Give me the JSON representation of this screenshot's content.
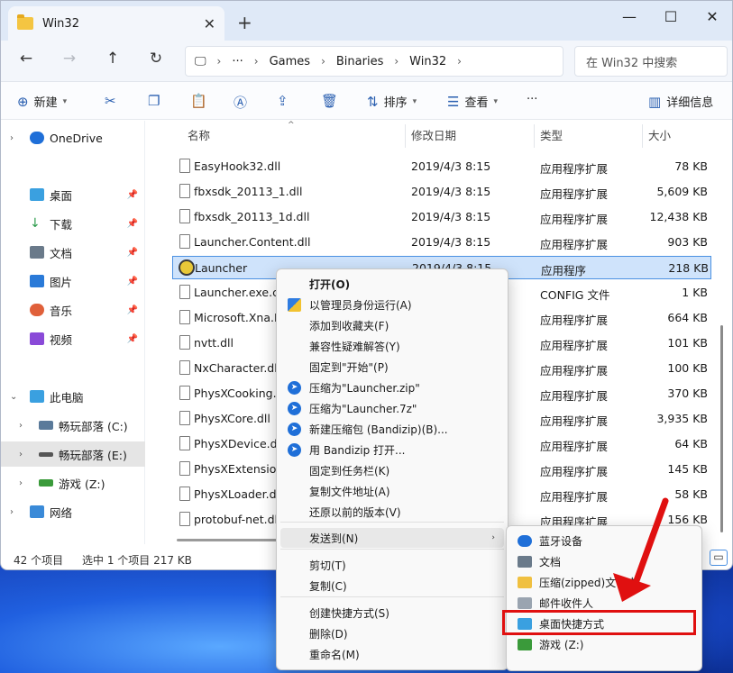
{
  "window": {
    "tab_title": "Win32",
    "close_tab": "✕",
    "new_tab": "+",
    "minimize": "—",
    "maximize": "☐",
    "close": "✕"
  },
  "address": {
    "crumbs": [
      "Games",
      "Binaries",
      "Win32"
    ],
    "ellipsis": "···",
    "search_placeholder": "在 Win32 中搜索"
  },
  "toolbar": {
    "new_label": "新建",
    "sort_label": "排序",
    "view_label": "查看",
    "more_label": "···",
    "details_label": "详细信息"
  },
  "nav": {
    "items": [
      {
        "label": "OneDrive",
        "color": "#1f6fd8"
      },
      {
        "label": "桌面",
        "color": "#3aa0e0"
      },
      {
        "label": "下载",
        "color": "#2a9a4a"
      },
      {
        "label": "文档",
        "color": "#6a7a8a"
      },
      {
        "label": "图片",
        "color": "#2a7ad8"
      },
      {
        "label": "音乐",
        "color": "#e0603a"
      },
      {
        "label": "视频",
        "color": "#8a4ad8"
      },
      {
        "label": "此电脑",
        "color": "#3aa0e0"
      },
      {
        "label": "畅玩部落 (C:)",
        "color": "#5a7a9a"
      },
      {
        "label": "畅玩部落 (E:)",
        "color": "#555555"
      },
      {
        "label": "游戏 (Z:)",
        "color": "#3a9a3a"
      },
      {
        "label": "网络",
        "color": "#3a8ad8"
      }
    ]
  },
  "columns": {
    "name": "名称",
    "date": "修改日期",
    "type": "类型",
    "size": "大小"
  },
  "files": [
    {
      "name": "EasyHook32.dll",
      "date": "2019/4/3 8:15",
      "type": "应用程序扩展",
      "size": "78 KB"
    },
    {
      "name": "fbxsdk_20113_1.dll",
      "date": "2019/4/3 8:15",
      "type": "应用程序扩展",
      "size": "5,609 KB"
    },
    {
      "name": "fbxsdk_20113_1d.dll",
      "date": "2019/4/3 8:15",
      "type": "应用程序扩展",
      "size": "12,438 KB"
    },
    {
      "name": "Launcher.Content.dll",
      "date": "2019/4/3 8:15",
      "type": "应用程序扩展",
      "size": "903 KB"
    },
    {
      "name": "Launcher",
      "date": "2019/4/3 8:15",
      "type": "应用程序",
      "size": "218 KB"
    },
    {
      "name": "Launcher.exe.cc",
      "date": "",
      "type": "CONFIG 文件",
      "size": "1 KB"
    },
    {
      "name": "Microsoft.Xna.F",
      "date": "",
      "type": "应用程序扩展",
      "size": "664 KB"
    },
    {
      "name": "nvtt.dll",
      "date": "",
      "type": "应用程序扩展",
      "size": "101 KB"
    },
    {
      "name": "NxCharacter.dll",
      "date": "",
      "type": "应用程序扩展",
      "size": "100 KB"
    },
    {
      "name": "PhysXCooking.d",
      "date": "",
      "type": "应用程序扩展",
      "size": "370 KB"
    },
    {
      "name": "PhysXCore.dll",
      "date": "",
      "type": "应用程序扩展",
      "size": "3,935 KB"
    },
    {
      "name": "PhysXDevice.dll",
      "date": "",
      "type": "应用程序扩展",
      "size": "64 KB"
    },
    {
      "name": "PhysXExtension",
      "date": "",
      "type": "应用程序扩展",
      "size": "145 KB"
    },
    {
      "name": "PhysXLoader.dl",
      "date": "",
      "type": "应用程序扩展",
      "size": "58 KB"
    },
    {
      "name": "protobuf-net.dl",
      "date": "",
      "type": "应用程序扩展",
      "size": "156 KB"
    }
  ],
  "status": {
    "count": "42 个项目",
    "selected": "选中 1 个项目  217 KB"
  },
  "context_menu": {
    "items": [
      {
        "label": "打开(O)",
        "icon": "",
        "bold": true
      },
      {
        "label": "以管理员身份运行(A)",
        "icon": "shield"
      },
      {
        "label": "添加到收藏夹(F)",
        "icon": ""
      },
      {
        "label": "兼容性疑难解答(Y)",
        "icon": ""
      },
      {
        "label": "固定到\"开始\"(P)",
        "icon": ""
      },
      {
        "label": "压缩为\"Launcher.zip\"",
        "icon": "bandizip"
      },
      {
        "label": "压缩为\"Launcher.7z\"",
        "icon": "bandizip"
      },
      {
        "label": "新建压缩包 (Bandizip)(B)...",
        "icon": "bandizip"
      },
      {
        "label": "用 Bandizip 打开...",
        "icon": "bandizip"
      },
      {
        "label": "固定到任务栏(K)",
        "icon": ""
      },
      {
        "label": "复制文件地址(A)",
        "icon": ""
      },
      {
        "label": "还原以前的版本(V)",
        "icon": ""
      },
      {
        "label": "发送到(N)",
        "icon": "",
        "submenu": true
      },
      {
        "label": "剪切(T)",
        "icon": ""
      },
      {
        "label": "复制(C)",
        "icon": ""
      },
      {
        "label": "创建快捷方式(S)",
        "icon": ""
      },
      {
        "label": "删除(D)",
        "icon": ""
      },
      {
        "label": "重命名(M)",
        "icon": ""
      }
    ],
    "submenu_arrow": "›"
  },
  "send_to": {
    "items": [
      {
        "label": "蓝牙设备",
        "color": "#1f6fd8"
      },
      {
        "label": "文档",
        "color": "#6a7a8a"
      },
      {
        "label": "压缩(zipped)文件夹",
        "color": "#f0c040"
      },
      {
        "label": "邮件收件人",
        "color": "#9aa4b0"
      },
      {
        "label": "桌面快捷方式",
        "color": "#3aa0e0"
      },
      {
        "label": "游戏 (Z:)",
        "color": "#3a9a3a"
      }
    ]
  }
}
